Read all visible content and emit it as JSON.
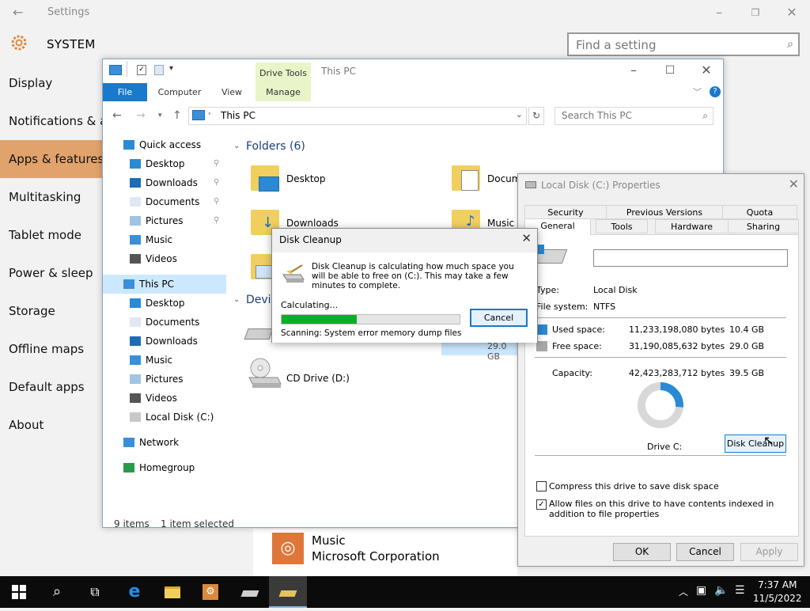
{
  "settings": {
    "title": "Settings",
    "header": "SYSTEM",
    "search_placeholder": "Find a setting",
    "nav": [
      "Display",
      "Notifications & actions",
      "Apps & features",
      "Multitasking",
      "Tablet mode",
      "Power & sleep",
      "Storage",
      "Offline maps",
      "Default apps",
      "About"
    ],
    "selected_nav_index": 2,
    "app_row": {
      "name": "Music",
      "publisher": "Microsoft Corporation"
    }
  },
  "explorer": {
    "context_tab": "Drive Tools",
    "title": "This PC",
    "tabs": {
      "file": "File",
      "computer": "Computer",
      "view": "View",
      "manage": "Manage"
    },
    "address": "This PC",
    "search_placeholder": "Search This PC",
    "tree": {
      "quick_access": "Quick access",
      "qa_items": [
        "Desktop",
        "Downloads",
        "Documents",
        "Pictures",
        "Music",
        "Videos"
      ],
      "this_pc": "This PC",
      "pc_items": [
        "Desktop",
        "Documents",
        "Downloads",
        "Music",
        "Pictures",
        "Videos",
        "Local Disk (C:)"
      ],
      "network": "Network",
      "homegroup": "Homegroup"
    },
    "folders_header": "Folders (6)",
    "folders": [
      "Desktop",
      "Downloads",
      "Docum",
      "Music"
    ],
    "devices_header": "Devi",
    "drive_free": "29.0 GB",
    "cd_drive": "CD Drive (D:)",
    "status": {
      "items": "9 items",
      "selected": "1 item selected"
    }
  },
  "properties": {
    "title": "Local Disk (C:) Properties",
    "tabs_row1": [
      "Security",
      "Previous Versions",
      "Quota"
    ],
    "tabs_row2": [
      "General",
      "Tools",
      "Hardware",
      "Sharing"
    ],
    "type_label": "Type:",
    "type_value": "Local Disk",
    "fs_label": "File system:",
    "fs_value": "NTFS",
    "used_label": "Used space:",
    "used_bytes": "11,233,198,080 bytes",
    "used_gb": "10.4 GB",
    "free_label": "Free space:",
    "free_bytes": "31,190,085,632 bytes",
    "free_gb": "29.0 GB",
    "capacity_label": "Capacity:",
    "capacity_bytes": "42,423,283,712 bytes",
    "capacity_gb": "39.5 GB",
    "drive_label": "Drive C:",
    "cleanup_button": "Disk Cleanup",
    "compress_label": "Compress this drive to save disk space",
    "index_label": "Allow files on this drive to have contents indexed in addition to file properties",
    "ok": "OK",
    "cancel": "Cancel",
    "apply": "Apply",
    "colors": {
      "used": "#2a8ad4",
      "free": "#a8a8a8"
    }
  },
  "cleanup": {
    "title": "Disk Cleanup",
    "message": "Disk Cleanup is calculating how much space you will be able to free on  (C:). This may take a few minutes to complete.",
    "calculating": "Calculating...",
    "cancel": "Cancel",
    "scanning_label": "Scanning:",
    "scanning_item": "System error memory dump files",
    "progress": 0.42
  },
  "taskbar": {
    "time": "7:37 AM",
    "date": "11/5/2022"
  }
}
